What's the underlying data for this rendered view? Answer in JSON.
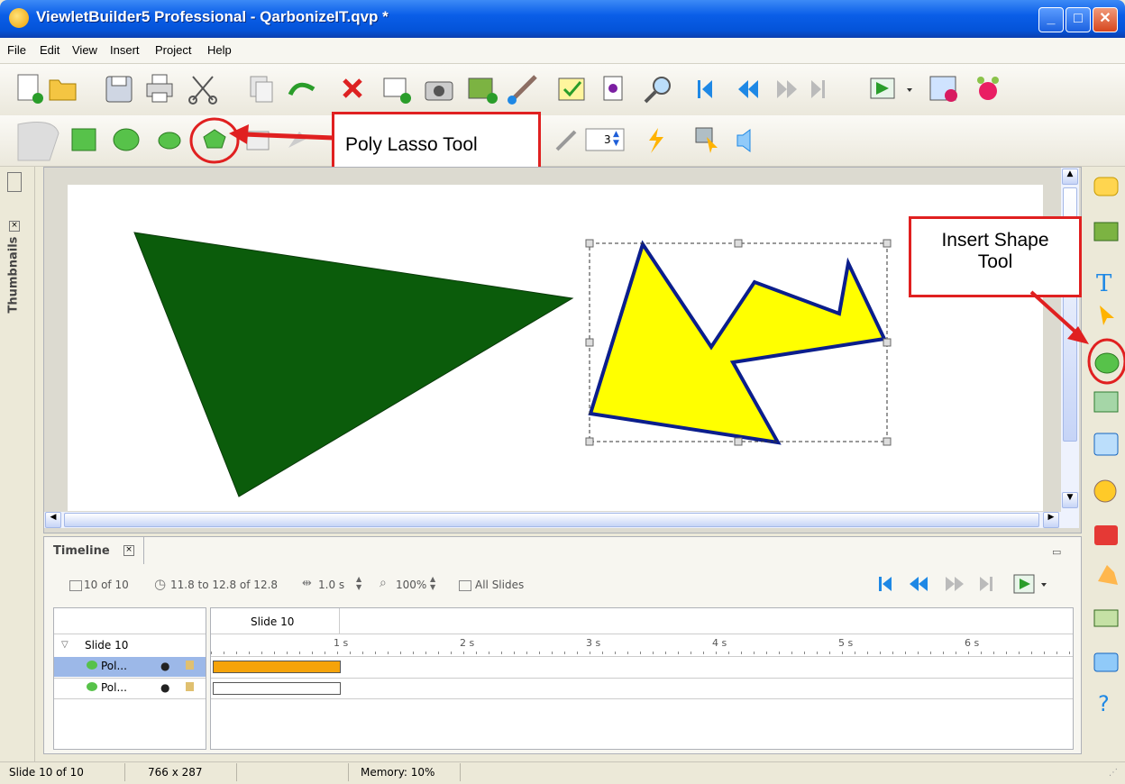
{
  "window": {
    "title": "ViewletBuilder5 Professional - QarbonizeIT.qvp *"
  },
  "window_controls": {
    "minimize": "_",
    "maximize": "□",
    "close": "✕"
  },
  "menu": [
    "File",
    "Edit",
    "View",
    "Insert",
    "Project",
    "Help"
  ],
  "toolbar2": {
    "line_width_value": "3"
  },
  "left_panel": {
    "thumbnails_label": "Thumbnails"
  },
  "callouts": {
    "poly_lasso": "Poly Lasso Tool",
    "insert_shape_line1": "Insert Shape",
    "insert_shape_line2": "Tool"
  },
  "timeline": {
    "title": "Timeline",
    "slide_count": "10 of 10",
    "time_range": "11.8 to 12.8 of 12.8",
    "duration": "1.0 s",
    "zoom": "100%",
    "all_slides": "All Slides",
    "slide_header": "Slide 10",
    "tree_root": "Slide 10",
    "layers": [
      {
        "name": "Pol...",
        "bar_duration_s": 1.0,
        "bar_color": "#f5a30a"
      },
      {
        "name": "Pol...",
        "bar_duration_s": 1.0,
        "bar_color": "#ffffff"
      }
    ],
    "ruler_labels": [
      "1 s",
      "2 s",
      "3 s",
      "4 s",
      "5 s",
      "6 s"
    ]
  },
  "status": {
    "slide": "Slide 10 of 10",
    "size": "766 x 287",
    "memory": "Memory: 10%"
  },
  "shapes": {
    "triangle_color": "#0b5c0b",
    "arrow_fill": "#ffff00",
    "arrow_stroke": "#0b1e8c"
  },
  "colors": {
    "callout_border": "#e02020",
    "selection_bar": "#9cb8e8"
  }
}
